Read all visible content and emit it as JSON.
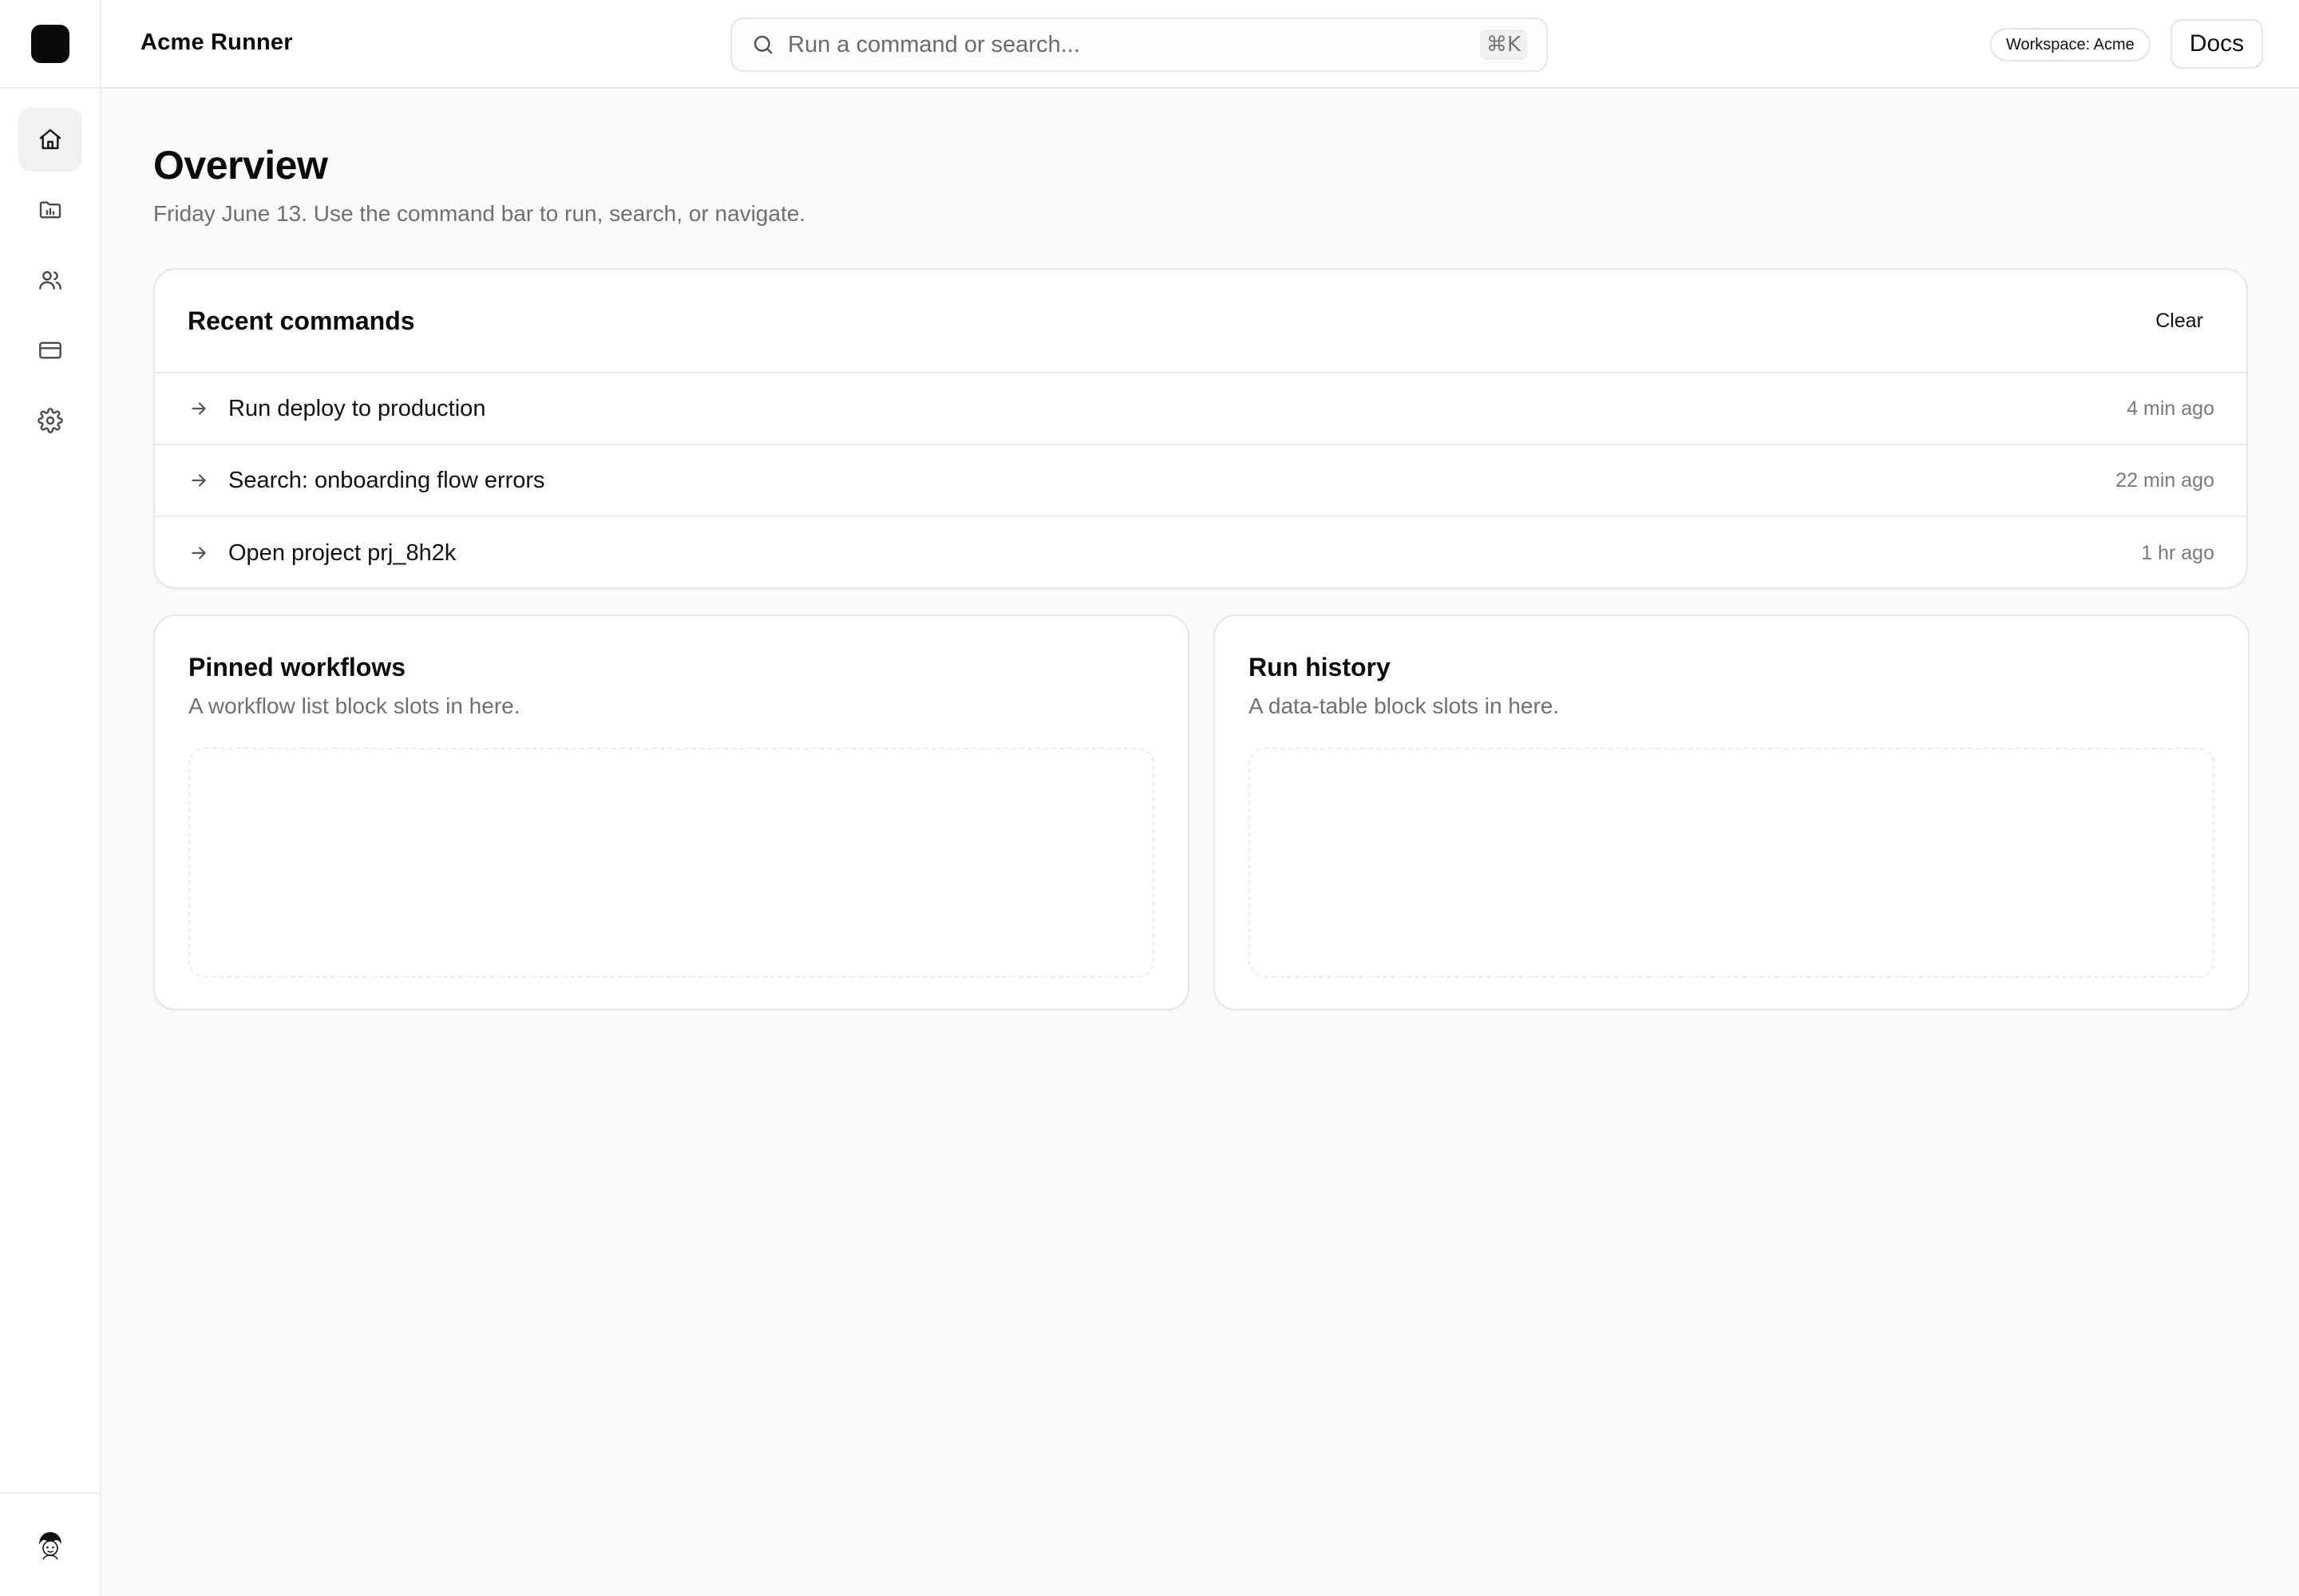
{
  "app": {
    "title": "Acme Runner"
  },
  "sidebar": {
    "items": [
      {
        "name": "home",
        "icon": "home-icon",
        "active": true
      },
      {
        "name": "projects",
        "icon": "folder-chart-icon",
        "active": false
      },
      {
        "name": "team",
        "icon": "users-icon",
        "active": false
      },
      {
        "name": "billing",
        "icon": "credit-card-icon",
        "active": false
      },
      {
        "name": "settings",
        "icon": "gear-icon",
        "active": false
      }
    ]
  },
  "header": {
    "search": {
      "placeholder": "Run a command or search...",
      "shortcut": "⌘K"
    },
    "workspace_badge": "Workspace: Acme",
    "docs_label": "Docs"
  },
  "main": {
    "title": "Overview",
    "subtitle": "Friday June 13. Use the command bar to run, search, or navigate.",
    "recent": {
      "title": "Recent commands",
      "clear_label": "Clear",
      "items": [
        {
          "label": "Run deploy to production",
          "time": "4 min ago"
        },
        {
          "label": "Search: onboarding flow errors",
          "time": "22 min ago"
        },
        {
          "label": "Open project prj_8h2k",
          "time": "1 hr ago"
        }
      ]
    },
    "pinned": {
      "title": "Pinned workflows",
      "description": "A workflow list block slots in here."
    },
    "history": {
      "title": "Run history",
      "description": "A data-table block slots in here."
    }
  }
}
